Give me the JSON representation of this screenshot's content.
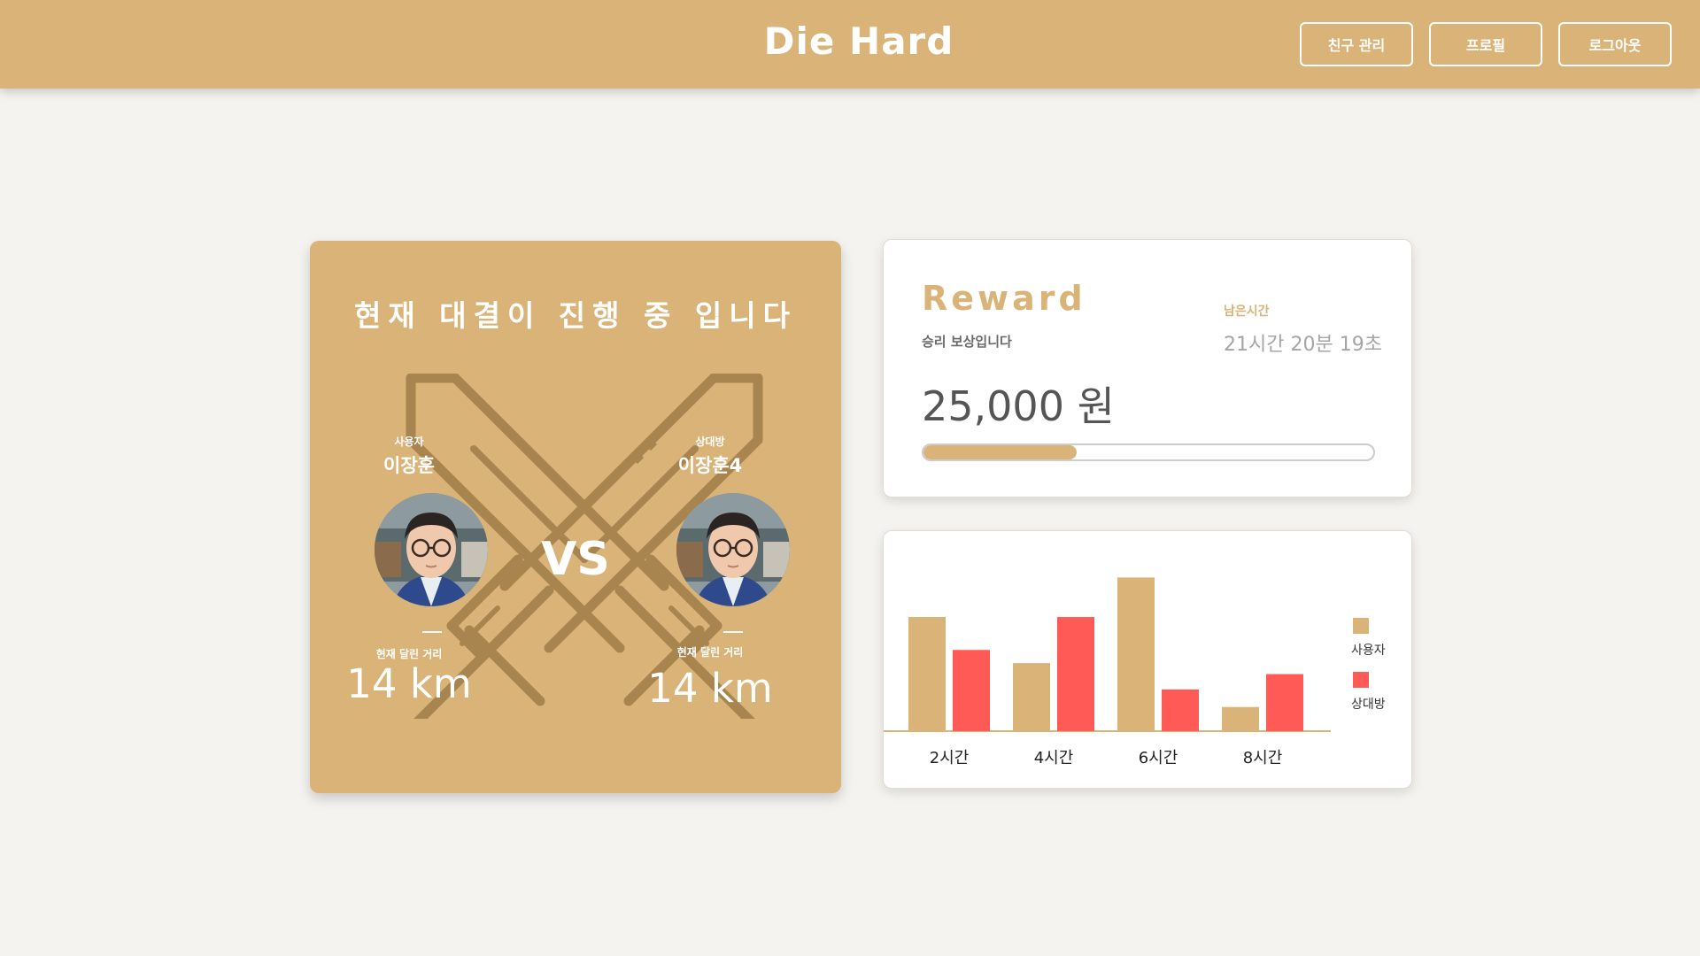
{
  "header": {
    "logo": "Die Hard",
    "nav": [
      "친구 관리",
      "프로필",
      "로그아웃"
    ]
  },
  "match": {
    "title": "현재 대결이 진행 중 입니다",
    "vs": "VS",
    "user": {
      "role": "사용자",
      "name": "이장훈",
      "distance_label": "현재 달린 거리",
      "distance": "14 km"
    },
    "opponent": {
      "role": "상대방",
      "name": "이장훈4",
      "distance_label": "현재 달린 거리",
      "distance": "14 km"
    }
  },
  "reward": {
    "title": "Reward",
    "subtitle": "승리 보상입니다",
    "remaining_label": "남은시간",
    "remaining_value": "21시간 20분 19초",
    "amount": "25,000 원",
    "progress": 0.34
  },
  "colors": {
    "accent": "#d9b377",
    "opponent": "#ff5a55"
  },
  "chart_data": {
    "type": "bar",
    "categories": [
      "2시간",
      "4시간",
      "6시간",
      "8시간"
    ],
    "series": [
      {
        "name": "사용자",
        "values": [
          52,
          31,
          70,
          11
        ],
        "color": "#d9b377"
      },
      {
        "name": "상대방",
        "values": [
          37,
          52,
          19,
          26
        ],
        "color": "#ff5a55"
      }
    ],
    "ylim": [
      0,
      75
    ],
    "grid": false,
    "legend": "right"
  }
}
